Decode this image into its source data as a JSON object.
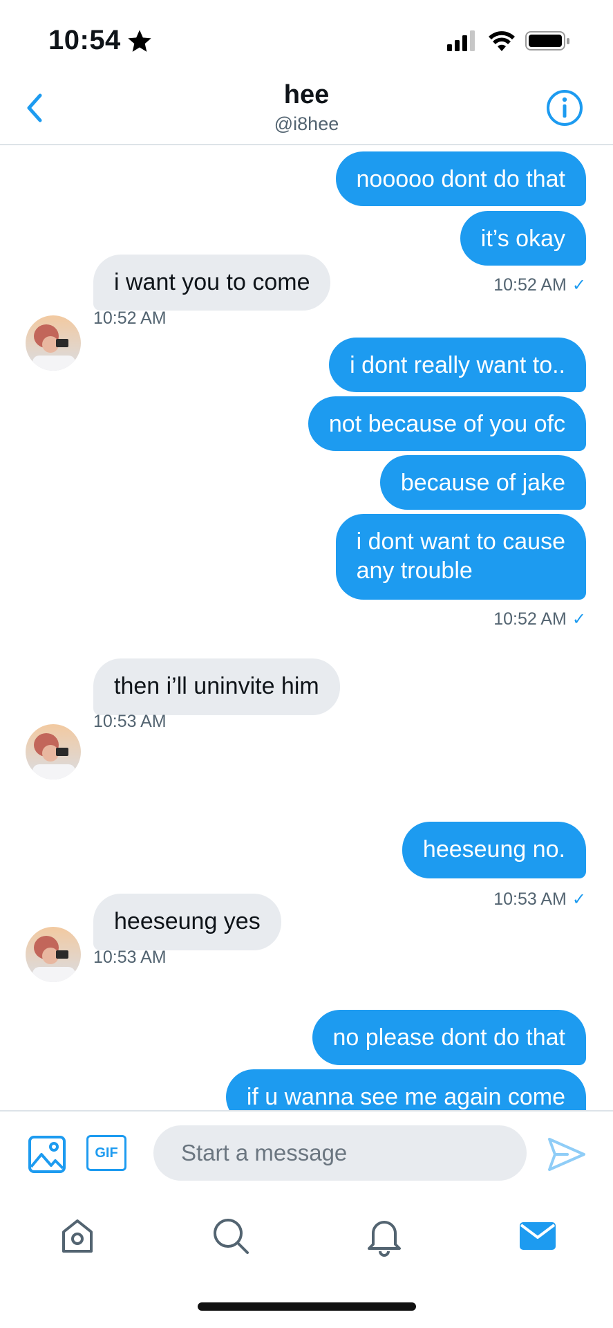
{
  "status_bar": {
    "time": "10:54"
  },
  "header": {
    "name": "hee",
    "handle": "@i8hee"
  },
  "messages": [
    {
      "text": "nooooo dont do that"
    },
    {
      "text": "it’s okay"
    },
    {
      "time": "10:52 AM"
    },
    {
      "text": "i want you to come"
    },
    {
      "time": "10:52 AM"
    },
    {
      "text": "i dont really want to.."
    },
    {
      "text": "not because of you ofc"
    },
    {
      "text": "because of jake"
    },
    {
      "text": "i dont want to cause\nany trouble"
    },
    {
      "time": "10:52 AM"
    },
    {
      "text": "then i’ll uninvite him"
    },
    {
      "time": "10:53 AM"
    },
    {
      "text": "heeseung no."
    },
    {
      "time": "10:53 AM"
    },
    {
      "text": "heeseung yes"
    },
    {
      "time": "10:53 AM"
    },
    {
      "text": "no please dont do that"
    },
    {
      "text": "if u wanna see me again come"
    }
  ],
  "composer": {
    "placeholder": "Start a message",
    "gif_label": "GIF"
  },
  "colors": {
    "accent": "#1d9bf0",
    "incoming_bubble": "#e8ebef",
    "muted": "#536471"
  }
}
